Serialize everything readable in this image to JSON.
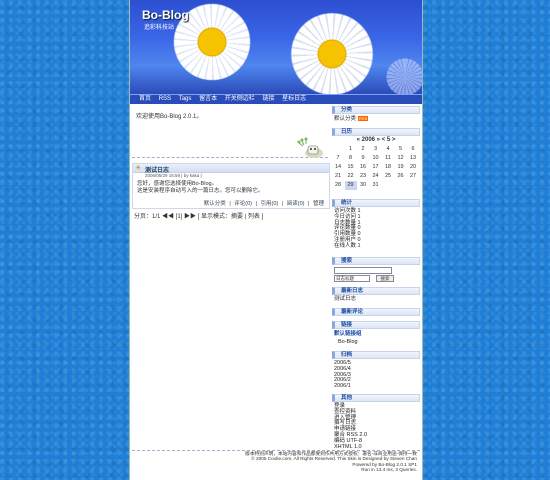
{
  "header": {
    "title": "Bo-Blog",
    "subtitle": "追彩科技站",
    "nav": [
      "首页",
      "RSS",
      "Tags",
      "留言本",
      "开关侧边栏",
      "链接",
      "星标日志"
    ]
  },
  "main": {
    "welcome": "欢迎使用Bo-Blog 2.0.1。",
    "post": {
      "title": "测试日志",
      "meta": "2006/05/29 16:59 | by kaka |",
      "body_line1": "您好，感谢您选择使用Bo-Blog。",
      "body_line2": "这是安装程序自动写入的一篇日志。您可以删除它。",
      "actions": [
        "默认分类",
        "|",
        "评论(0)",
        "|",
        "引用(0)",
        "|",
        "阅读(0)",
        "|",
        "管理"
      ]
    },
    "paging": "分页：1/1 ◀◀ [1] ▶▶ [ 显示模式：摘要 | 列表 ]"
  },
  "sidebar": {
    "category_head": "分类",
    "category_item": "默认分类",
    "category_badge": "RSS",
    "calendar_head": "日历",
    "calendar_title": "« 2006 »  < 5 >",
    "calendar_rows": [
      [
        "",
        "1",
        "2",
        "3",
        "4",
        "5",
        "6"
      ],
      [
        "7",
        "8",
        "9",
        "10",
        "11",
        "12",
        "13"
      ],
      [
        "14",
        "15",
        "16",
        "17",
        "18",
        "19",
        "20"
      ],
      [
        "21",
        "22",
        "23",
        "24",
        "25",
        "26",
        "27"
      ],
      [
        "28",
        "29",
        "30",
        "31",
        "",
        "",
        ""
      ]
    ],
    "stats_head": "统计",
    "stats": [
      "访问次数 1",
      "今日访问 1",
      "日志数量 1",
      "评论数量 0",
      "引用数量 0",
      "注册用户 0",
      "在线人数 1"
    ],
    "search_head": "搜索",
    "search_select": "日志标题",
    "search_button": "搜索",
    "latest_head": "最新日志",
    "latest_item": "测试日志",
    "latest_comments_head": "最新评论",
    "links_head": "链接",
    "links_sub": "默认链接组",
    "links_item": "Bo-Blog",
    "archive_head": "归档",
    "archive": [
      "2006/5",
      "2006/4",
      "2006/3",
      "2006/2",
      "2006/1"
    ],
    "other_head": "其他",
    "other": [
      "登录",
      "查控资料",
      "进入管理",
      "撰写日志",
      "申请链接",
      "聚合 RSS 2.0",
      "编码 UTF-8",
      "XHTML 1.0"
    ]
  },
  "footer": {
    "line1": "版本特别声明，本站内容和作品都受到作共用方式授权：署名-非商业用途-保持一致",
    "line2": "© 2005 Coolie.com, All Rights Reserved. This Skin is Designed by Steven Chan",
    "line3": "Powered by Bo-Blog 2.0.1 SP1",
    "line4": "Run in 13.4 ms, 3 Queries."
  }
}
